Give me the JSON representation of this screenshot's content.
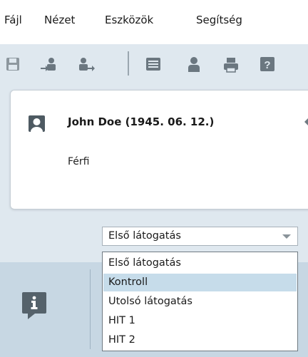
{
  "menu": {
    "file": "Fájl",
    "view": "Nézet",
    "tools": "Eszközök",
    "help": "Segítség"
  },
  "toolbar": {
    "icons": [
      "save-icon",
      "import-user-icon",
      "export-user-icon",
      "form-icon",
      "user-icon",
      "print-icon",
      "help-icon"
    ],
    "icon_color": "#6b7780"
  },
  "patient": {
    "name": "John Doe (1945. 06. 12.)",
    "gender": "Férfi"
  },
  "visit_select": {
    "value": "Első látogatás",
    "options": [
      "Első látogatás",
      "Kontroll",
      "Utolsó látogatás",
      "HIT 1",
      "HIT 2"
    ],
    "highlighted_index": 1
  },
  "colors": {
    "accent": "#c6dcea",
    "background": "#dfe8ef",
    "panel": "#c7d7e3"
  }
}
